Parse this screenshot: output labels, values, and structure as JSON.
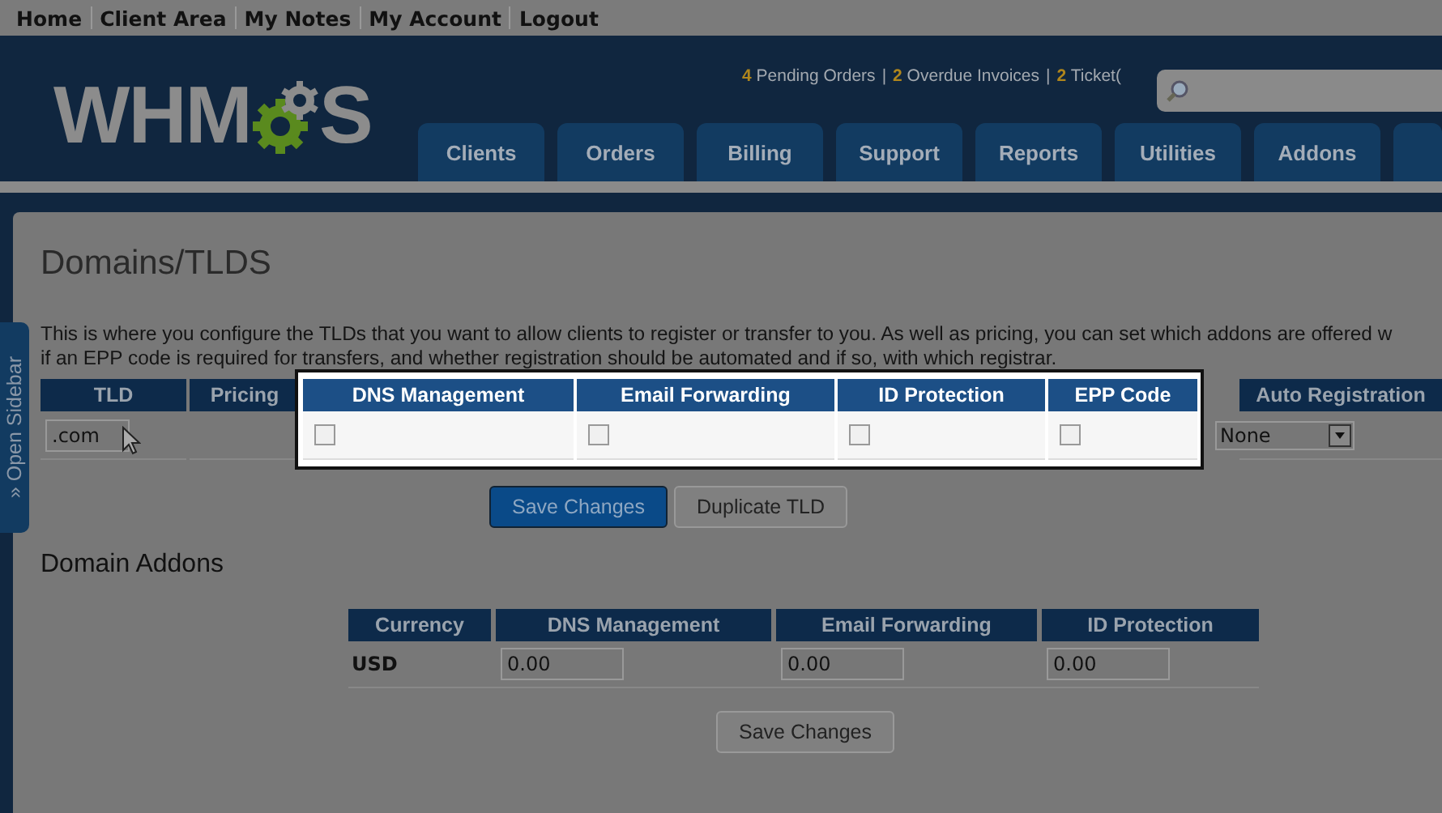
{
  "top_nav": [
    "Home",
    "Client Area",
    "My Notes",
    "My Account",
    "Logout"
  ],
  "logo": {
    "before": "WHM",
    "after": "S"
  },
  "stats": [
    {
      "count": "4",
      "label": "Pending Orders",
      "separator": "|"
    },
    {
      "count": "2",
      "label": "Overdue Invoices",
      "separator": "|"
    },
    {
      "count": "2",
      "label": "Ticket("
    }
  ],
  "nav_tabs": [
    "Clients",
    "Orders",
    "Billing",
    "Support",
    "Reports",
    "Utilities",
    "Addons"
  ],
  "sidebar_toggle": "» Open Sidebar",
  "page_title": "Domains/TLDS",
  "description": [
    "This is where you configure the TLDs that you want to allow clients to register or transfer to you. As well as pricing, you can set which addons are offered w",
    "if an EPP code is required for transfers, and whether registration should be automated and if so, with which registrar."
  ],
  "tld_table": {
    "columns": [
      "TLD",
      "Pricing",
      "Auto Registration"
    ],
    "tld": ".com",
    "auto_registration": "None"
  },
  "popup": {
    "columns": [
      {
        "label": "DNS Management",
        "checked": false
      },
      {
        "label": "Email Forwarding",
        "checked": false
      },
      {
        "label": "ID Protection",
        "checked": false
      },
      {
        "label": "EPP Code",
        "checked": false
      }
    ]
  },
  "buttons": [
    {
      "label": "Save Changes",
      "kind": "primary"
    },
    {
      "label": "Duplicate TLD",
      "kind": "secondary"
    }
  ],
  "addons": {
    "title": "Domain Addons",
    "columns": [
      "Currency",
      "DNS Management",
      "Email Forwarding",
      "ID Protection"
    ],
    "rows": [
      {
        "currency": "USD",
        "values": [
          "0.00",
          "0.00",
          "0.00"
        ]
      }
    ],
    "button": "Save Changes"
  }
}
